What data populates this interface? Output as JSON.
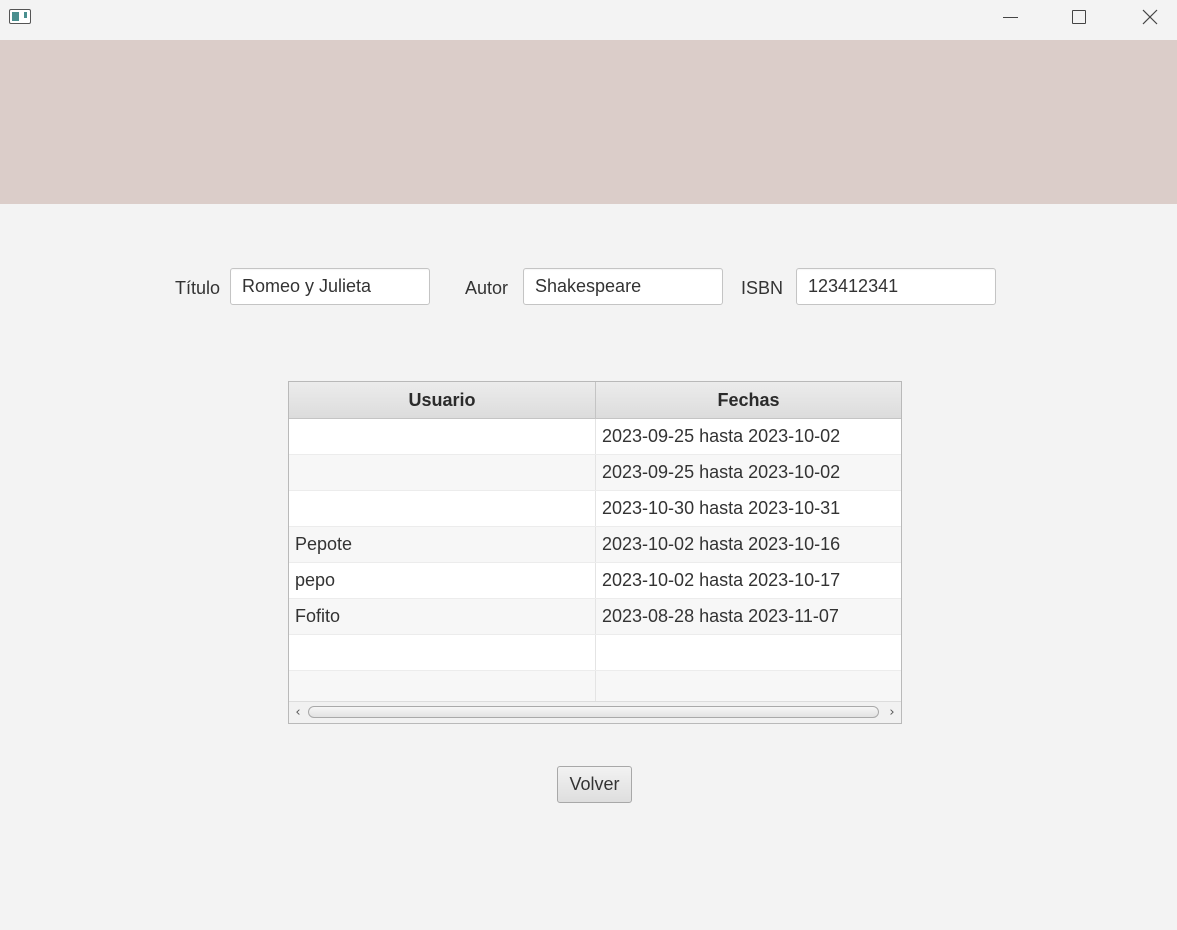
{
  "window": {
    "title": ""
  },
  "form": {
    "titulo_label": "Título",
    "titulo_value": "Romeo y Julieta",
    "autor_label": "Autor",
    "autor_value": "Shakespeare",
    "isbn_label": "ISBN",
    "isbn_value": "123412341"
  },
  "table": {
    "columns": [
      "Usuario",
      "Fechas"
    ],
    "rows": [
      [
        "",
        "2023-09-25 hasta 2023-10-02"
      ],
      [
        "",
        "2023-09-25 hasta 2023-10-02"
      ],
      [
        "",
        "2023-10-30 hasta 2023-10-31"
      ],
      [
        "Pepote",
        "2023-10-02 hasta 2023-10-16"
      ],
      [
        "pepo",
        "2023-10-02 hasta 2023-10-17"
      ],
      [
        "Fofito",
        "2023-08-28 hasta 2023-11-07"
      ],
      [
        "",
        ""
      ],
      [
        "",
        ""
      ]
    ]
  },
  "actions": {
    "volver_label": "Volver"
  },
  "colors": {
    "banner": "#dbcdc9",
    "background": "#f3f3f3"
  }
}
